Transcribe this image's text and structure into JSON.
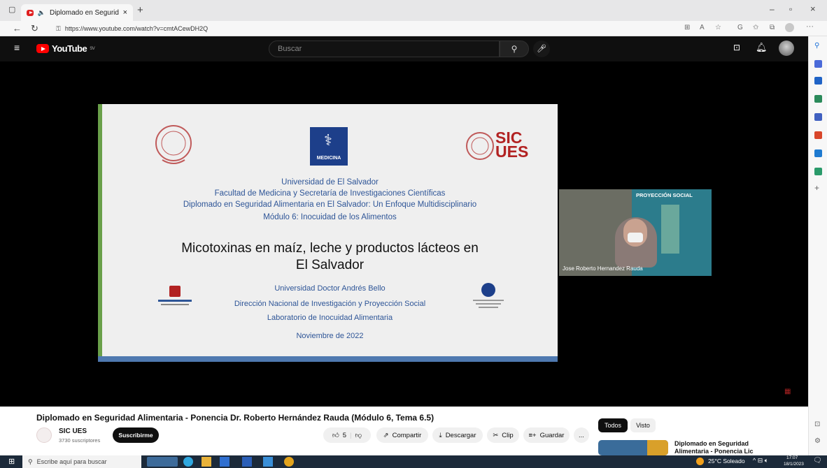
{
  "browser": {
    "tab_title": "Diplomado en Seguridad Al",
    "url": "https://www.youtube.com/watch?v=cmtACewDH2Q"
  },
  "youtube": {
    "logo_text": "YouTube",
    "country_code": "SV",
    "search_placeholder": "Buscar"
  },
  "slide": {
    "logo_right": "SIC",
    "logo_right2": "UES",
    "logo_center": "MEDICINA",
    "lines": [
      "Universidad de El Salvador",
      "Facultad de Medicina y Secretaría de Investigaciones Científicas",
      "Diplomado en Seguridad Alimentaria en El Salvador: Un Enfoque Multidisciplinario",
      "Módulo 6: Inocuidad de los Alimentos"
    ],
    "title_line1": "Micotoxinas en maíz, leche y productos lácteos en",
    "title_line2": "El Salvador",
    "footer_lines": [
      "Universidad Doctor Andrés Bello",
      "Dirección Nacional de Investigación y Proyección Social",
      "Laboratorio de Inocuidad Alimentaria"
    ],
    "date": "Noviembre de 2022"
  },
  "webcam": {
    "banner": "PROYECCIÓN SOCIAL",
    "speaker_label": "Jose Roberto Hernandez Rauda"
  },
  "video": {
    "title": "Diplomado en Seguridad Alimentaria - Ponencia Dr. Roberto Hernández Rauda (Módulo 6, Tema 6.5)",
    "channel": "SIC UES",
    "subscribers": "3730 suscriptores",
    "subscribe": "Suscribirme",
    "likes": "5",
    "share": "Compartir",
    "download": "Descargar",
    "clip": "Clip",
    "save": "Guardar",
    "more": "..."
  },
  "recommendations": {
    "chips": [
      "Todos",
      "Visto"
    ],
    "first_title_line1": "Diplomado en Seguridad",
    "first_title_line2": "Alimentaria - Ponencia Lic"
  },
  "taskbar": {
    "search_placeholder": "Escribe aquí para buscar",
    "weather": "25°C  Soleado",
    "time": "17:07",
    "date": "18/1/2023"
  }
}
